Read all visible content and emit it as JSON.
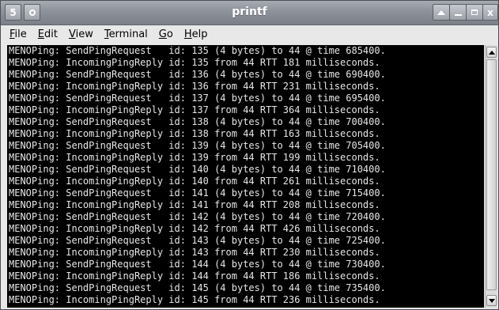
{
  "window": {
    "title": "printf",
    "menu_button_glyph": "5",
    "accent_color": "#8d9199"
  },
  "menubar": {
    "items": [
      {
        "mnemonic": "F",
        "rest": "ile"
      },
      {
        "mnemonic": "E",
        "rest": "dit"
      },
      {
        "mnemonic": "V",
        "rest": "iew"
      },
      {
        "mnemonic": "T",
        "rest": "erminal"
      },
      {
        "mnemonic": "G",
        "rest": "o"
      },
      {
        "mnemonic": "H",
        "rest": "elp"
      }
    ]
  },
  "terminal": {
    "background": "#000000",
    "foreground": "#e6e6e6",
    "lines": [
      "MENOPing: SendPingRequest   id: 135 (4 bytes) to 44 @ time 685400.",
      "MENOPing: IncomingPingReply id: 135 from 44 RTT 181 milliseconds.",
      "MENOPing: SendPingRequest   id: 136 (4 bytes) to 44 @ time 690400.",
      "MENOPing: IncomingPingReply id: 136 from 44 RTT 231 milliseconds.",
      "MENOPing: SendPingRequest   id: 137 (4 bytes) to 44 @ time 695400.",
      "MENOPing: IncomingPingReply id: 137 from 44 RTT 364 milliseconds.",
      "MENOPing: SendPingRequest   id: 138 (4 bytes) to 44 @ time 700400.",
      "MENOPing: IncomingPingReply id: 138 from 44 RTT 163 milliseconds.",
      "MENOPing: SendPingRequest   id: 139 (4 bytes) to 44 @ time 705400.",
      "MENOPing: IncomingPingReply id: 139 from 44 RTT 199 milliseconds.",
      "MENOPing: SendPingRequest   id: 140 (4 bytes) to 44 @ time 710400.",
      "MENOPing: IncomingPingReply id: 140 from 44 RTT 261 milliseconds.",
      "MENOPing: SendPingRequest   id: 141 (4 bytes) to 44 @ time 715400.",
      "MENOPing: IncomingPingReply id: 141 from 44 RTT 208 milliseconds.",
      "MENOPing: SendPingRequest   id: 142 (4 bytes) to 44 @ time 720400.",
      "MENOPing: IncomingPingReply id: 142 from 44 RTT 426 milliseconds.",
      "MENOPing: SendPingRequest   id: 143 (4 bytes) to 44 @ time 725400.",
      "MENOPing: IncomingPingReply id: 143 from 44 RTT 230 milliseconds.",
      "MENOPing: SendPingRequest   id: 144 (4 bytes) to 44 @ time 730400.",
      "MENOPing: IncomingPingReply id: 144 from 44 RTT 186 milliseconds.",
      "MENOPing: SendPingRequest   id: 145 (4 bytes) to 44 @ time 735400.",
      "MENOPing: IncomingPingReply id: 145 from 44 RTT 236 milliseconds."
    ]
  },
  "icons": {
    "window_menu": "window-menu-icon",
    "sticky": "sticky-icon",
    "shade": "shade-icon",
    "minimize": "minimize-icon",
    "maximize": "maximize-icon",
    "close": "close-icon",
    "scroll_up": "scroll-up-arrow-icon",
    "scroll_down": "scroll-down-arrow-icon"
  },
  "titlebar_buttons": {
    "close_glyph": "x"
  }
}
